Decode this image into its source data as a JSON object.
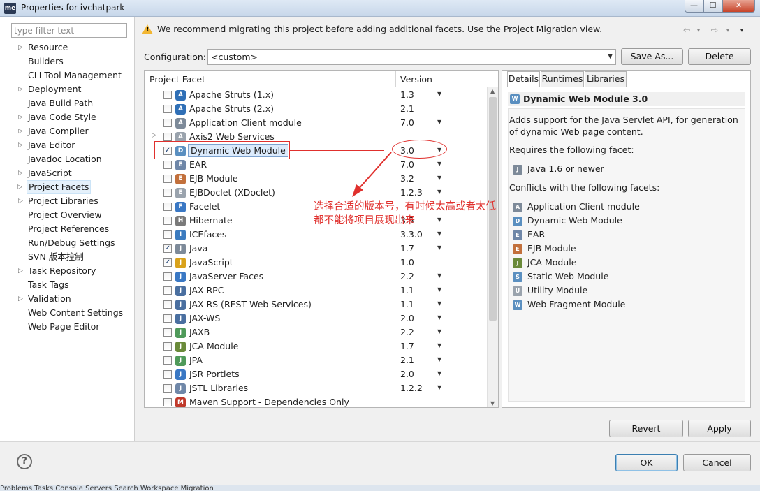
{
  "window": {
    "app_icon": "me",
    "title": "Properties for ivchatpark",
    "minimize": "—",
    "maximize": "☐",
    "close": "✕"
  },
  "left_pane": {
    "filter_placeholder": "type filter text",
    "items": [
      {
        "label": "Resource",
        "expandable": true
      },
      {
        "label": "Builders",
        "expandable": false
      },
      {
        "label": "CLI Tool Management",
        "expandable": false
      },
      {
        "label": "Deployment",
        "expandable": true
      },
      {
        "label": "Java Build Path",
        "expandable": false
      },
      {
        "label": "Java Code Style",
        "expandable": true
      },
      {
        "label": "Java Compiler",
        "expandable": true
      },
      {
        "label": "Java Editor",
        "expandable": true
      },
      {
        "label": "Javadoc Location",
        "expandable": false
      },
      {
        "label": "JavaScript",
        "expandable": true
      },
      {
        "label": "Project Facets",
        "expandable": true,
        "selected": true
      },
      {
        "label": "Project Libraries",
        "expandable": true
      },
      {
        "label": "Project Overview",
        "expandable": false
      },
      {
        "label": "Project References",
        "expandable": false
      },
      {
        "label": "Run/Debug Settings",
        "expandable": false
      },
      {
        "label": "SVN 版本控制",
        "expandable": false
      },
      {
        "label": "Task Repository",
        "expandable": true
      },
      {
        "label": "Task Tags",
        "expandable": false
      },
      {
        "label": "Validation",
        "expandable": true
      },
      {
        "label": "Web Content Settings",
        "expandable": false
      },
      {
        "label": "Web Page Editor",
        "expandable": false
      }
    ]
  },
  "header": {
    "warning": "We recommend migrating this project before adding additional facets. Use the Project Migration view.",
    "nav_back": "⇦",
    "nav_forward": "⇨",
    "nav_menu": "▾"
  },
  "configuration": {
    "label": "Configuration:",
    "value": "<custom>",
    "save_as": "Save As...",
    "delete": "Delete"
  },
  "facets": {
    "col_facet": "Project Facet",
    "col_version": "Version",
    "rows": [
      {
        "name": "Apache Struts (1.x)",
        "version": "1.3",
        "checked": false,
        "dd": true,
        "expand": false,
        "icon": "gear-icon",
        "color": "#2f6fb6"
      },
      {
        "name": "Apache Struts (2.x)",
        "version": "2.1",
        "checked": false,
        "dd": false,
        "expand": false,
        "icon": "gear-icon",
        "color": "#2f6fb6"
      },
      {
        "name": "Application Client module",
        "version": "7.0",
        "checked": false,
        "dd": true,
        "expand": false,
        "icon": "app-client-icon",
        "color": "#7d8a99"
      },
      {
        "name": "Axis2 Web Services",
        "version": "",
        "checked": false,
        "dd": false,
        "expand": true,
        "icon": "document-icon",
        "color": "#9aa3ad"
      },
      {
        "name": "Dynamic Web Module",
        "version": "3.0",
        "checked": true,
        "dd": true,
        "expand": false,
        "icon": "web-module-icon",
        "color": "#5a8fc0",
        "selected": true
      },
      {
        "name": "EAR",
        "version": "7.0",
        "checked": false,
        "dd": true,
        "expand": false,
        "icon": "ear-icon",
        "color": "#6f87a8"
      },
      {
        "name": "EJB Module",
        "version": "3.2",
        "checked": false,
        "dd": true,
        "expand": false,
        "icon": "ejb-icon",
        "color": "#c2703c"
      },
      {
        "name": "EJBDoclet (XDoclet)",
        "version": "1.2.3",
        "checked": false,
        "dd": true,
        "expand": false,
        "icon": "document-icon",
        "color": "#9aa3ad"
      },
      {
        "name": "Facelet",
        "version": "",
        "checked": false,
        "dd": false,
        "expand": false,
        "icon": "facelet-icon",
        "color": "#3a78c4"
      },
      {
        "name": "Hibernate",
        "version": "3.5",
        "checked": false,
        "dd": true,
        "expand": false,
        "icon": "hibernate-icon",
        "color": "#7a7a7a"
      },
      {
        "name": "ICEfaces",
        "version": "3.3.0",
        "checked": false,
        "dd": true,
        "expand": false,
        "icon": "icefaces-icon",
        "color": "#3b7bbf"
      },
      {
        "name": "Java",
        "version": "1.7",
        "checked": true,
        "dd": true,
        "expand": false,
        "icon": "java-icon",
        "color": "#7d8a99"
      },
      {
        "name": "JavaScript",
        "version": "1.0",
        "checked": true,
        "dd": false,
        "expand": false,
        "icon": "javascript-icon",
        "color": "#d9a21b"
      },
      {
        "name": "JavaServer Faces",
        "version": "2.2",
        "checked": false,
        "dd": true,
        "expand": false,
        "icon": "jsf-icon",
        "color": "#3a78c4"
      },
      {
        "name": "JAX-RPC",
        "version": "1.1",
        "checked": false,
        "dd": true,
        "expand": false,
        "icon": "jax-icon",
        "color": "#4a6fa0"
      },
      {
        "name": "JAX-RS (REST Web Services)",
        "version": "1.1",
        "checked": false,
        "dd": true,
        "expand": false,
        "icon": "jax-icon",
        "color": "#4a6fa0"
      },
      {
        "name": "JAX-WS",
        "version": "2.0",
        "checked": false,
        "dd": true,
        "expand": false,
        "icon": "jax-icon",
        "color": "#4a6fa0"
      },
      {
        "name": "JAXB",
        "version": "2.2",
        "checked": false,
        "dd": true,
        "expand": false,
        "icon": "jaxb-icon",
        "color": "#4f9a5a"
      },
      {
        "name": "JCA Module",
        "version": "1.7",
        "checked": false,
        "dd": true,
        "expand": false,
        "icon": "jca-icon",
        "color": "#6a8a3a"
      },
      {
        "name": "JPA",
        "version": "2.1",
        "checked": false,
        "dd": true,
        "expand": false,
        "icon": "jpa-icon",
        "color": "#4f9a5a"
      },
      {
        "name": "JSR Portlets",
        "version": "2.0",
        "checked": false,
        "dd": true,
        "expand": false,
        "icon": "portlet-icon",
        "color": "#3a78c4"
      },
      {
        "name": "JSTL Libraries",
        "version": "1.2.2",
        "checked": false,
        "dd": true,
        "expand": false,
        "icon": "jstl-icon",
        "color": "#6f87a8"
      },
      {
        "name": "Maven Support - Dependencies Only",
        "version": "",
        "checked": false,
        "dd": false,
        "expand": false,
        "icon": "maven-icon",
        "color": "#c0392b"
      }
    ]
  },
  "details": {
    "tabs": [
      "Details",
      "Runtimes",
      "Libraries"
    ],
    "title": "Dynamic Web Module 3.0",
    "description": "Adds support for the Java Servlet API, for generation of dynamic Web page content.",
    "requires_label": "Requires the following facet:",
    "requires": [
      {
        "name": "Java 1.6 or newer",
        "icon": "java-icon",
        "color": "#7d8a99"
      }
    ],
    "conflicts_label": "Conflicts with the following facets:",
    "conflicts": [
      {
        "name": "Application Client module",
        "icon": "app-client-icon",
        "color": "#7d8a99"
      },
      {
        "name": "Dynamic Web Module",
        "icon": "web-module-icon",
        "color": "#5a8fc0"
      },
      {
        "name": "EAR",
        "icon": "ear-icon",
        "color": "#6f87a8"
      },
      {
        "name": "EJB Module",
        "icon": "ejb-icon",
        "color": "#c2703c"
      },
      {
        "name": "JCA Module",
        "icon": "jca-icon",
        "color": "#6a8a3a"
      },
      {
        "name": "Static Web Module",
        "icon": "static-web-icon",
        "color": "#5a8fc0"
      },
      {
        "name": "Utility Module",
        "icon": "utility-icon",
        "color": "#9aa3ad"
      },
      {
        "name": "Web Fragment Module",
        "icon": "web-fragment-icon",
        "color": "#5a8fc0"
      }
    ]
  },
  "buttons": {
    "revert": "Revert",
    "apply": "Apply",
    "ok": "OK",
    "cancel": "Cancel",
    "help": "?"
  },
  "annotation": {
    "text": "选择合适的版本号，有时候太高或者太低都不能将项目展现出来",
    "color": "#e0302d"
  },
  "taskbar": "Problems  Tasks  Console  Servers  Search  Workspace Migration"
}
